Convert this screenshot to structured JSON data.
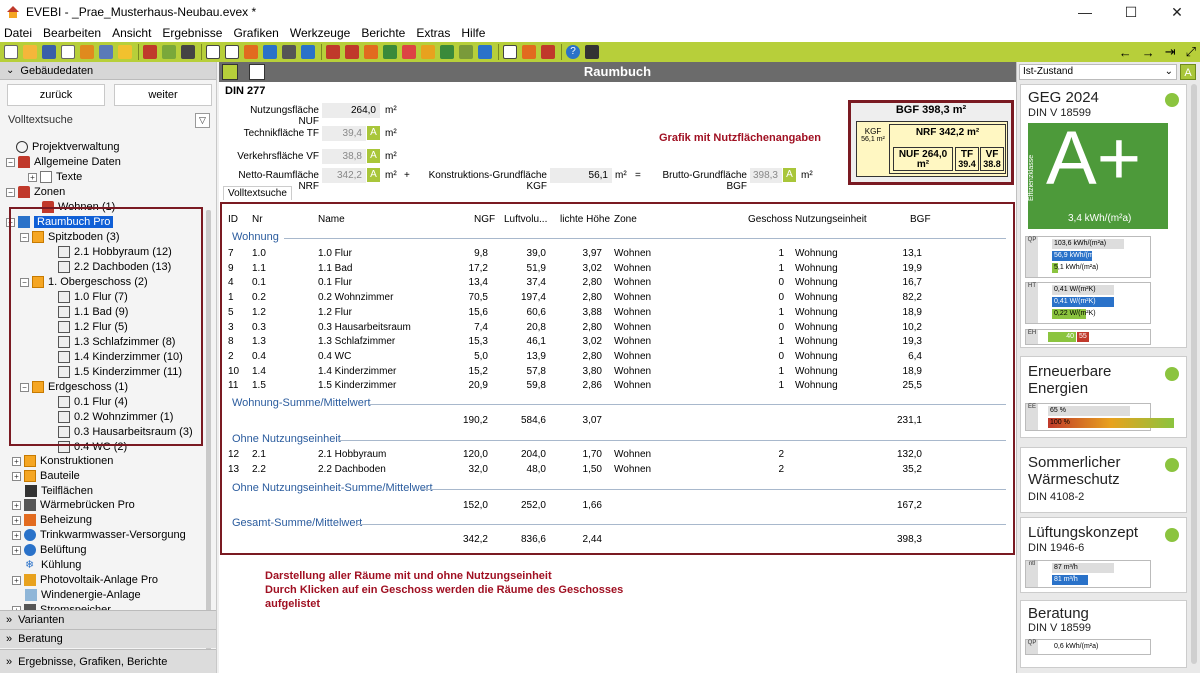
{
  "window": {
    "title": "EVEBI  - _Prae_Musterhaus-Neubau.evex *",
    "min": "—",
    "max": "☐",
    "close": "✕"
  },
  "menu": [
    "Datei",
    "Bearbeiten",
    "Ansicht",
    "Ergebnisse",
    "Grafiken",
    "Werkzeuge",
    "Berichte",
    "Extras",
    "Hilfe"
  ],
  "toolbar": {
    "back": "←",
    "forward": "→",
    "exit": "⇥",
    "zoom": "⤢"
  },
  "left": {
    "header": "Gebäudedaten",
    "back": "zurück",
    "next": "weiter",
    "search": "Volltextsuche",
    "tree": [
      {
        "label": "Projektverwaltung"
      },
      {
        "label": "Allgemeine Daten"
      },
      {
        "label": "Texte"
      },
      {
        "label": "Zonen"
      },
      {
        "label": "Wohnen (1)"
      },
      {
        "label": "Raumbuch Pro"
      },
      {
        "label": "Spitzboden (3)"
      },
      {
        "label": "2.1 Hobbyraum (12)"
      },
      {
        "label": "2.2 Dachboden (13)"
      },
      {
        "label": "1. Obergeschoss (2)"
      },
      {
        "label": "1.0 Flur (7)"
      },
      {
        "label": "1.1 Bad (9)"
      },
      {
        "label": "1.2 Flur (5)"
      },
      {
        "label": "1.3 Schlafzimmer (8)"
      },
      {
        "label": "1.4 Kinderzimmer (10)"
      },
      {
        "label": "1.5 Kinderzimmer (11)"
      },
      {
        "label": "Erdgeschoss (1)"
      },
      {
        "label": "0.1 Flur (4)"
      },
      {
        "label": "0.2 Wohnzimmer (1)"
      },
      {
        "label": "0.3 Hausarbeitsraum (3)"
      },
      {
        "label": "0.4 WC (2)"
      },
      {
        "label": "Konstruktionen"
      },
      {
        "label": "Bauteile"
      },
      {
        "label": "Teilflächen"
      },
      {
        "label": "Wärmebrücken Pro"
      },
      {
        "label": "Beheizung"
      },
      {
        "label": "Trinkwarmwasser-Versorgung"
      },
      {
        "label": "Belüftung"
      },
      {
        "label": "Kühlung"
      },
      {
        "label": "Photovoltaik-Anlage Pro"
      },
      {
        "label": "Windenergie-Anlage"
      },
      {
        "label": "Stromspeicher"
      }
    ],
    "sections": [
      "Varianten",
      "Beratung",
      "Ergebnisse, Grafiken, Berichte"
    ]
  },
  "main": {
    "title": "Raumbuch",
    "din": "DIN 277",
    "fields": {
      "nuf_label": "Nutzungsfläche NUF",
      "nuf": "264,0",
      "tf_label": "Technikfläche TF",
      "tf": "39,4",
      "vf_label": "Verkehrsfläche VF",
      "vf": "38,8",
      "nrf_label": "Netto-Raumfläche NRF",
      "nrf": "342,2",
      "kgf_label": "Konstruktions-Grundfläche KGF",
      "kgf": "56,1",
      "bgf_label": "Brutto-Grundfläche BGF",
      "bgf": "398,3",
      "unit": "m²",
      "a": "A",
      "plus": "+",
      "eq": "="
    },
    "graphic": {
      "bgf": "BGF 398,3 m²",
      "kgf": "KGF",
      "kgf_val": "56,1 m²",
      "nrf": "NRF 342,2 m²",
      "nuf": "NUF 264,0",
      "nuf_unit": "m²",
      "tf": "TF",
      "tf_val": "39.4",
      "vf": "VF",
      "vf_val": "38.8"
    },
    "annotation_graphic": "Grafik mit Nutzflächenangaben",
    "tab": "Volltextsuche",
    "columns": [
      "ID",
      "Nr",
      "Name",
      "NGF",
      "Luftvolu...",
      "lichte Höhe",
      "Zone",
      "Geschoss",
      "Nutzungseinheit",
      "BGF"
    ],
    "groups": [
      {
        "name": "Wohnung",
        "rows": [
          [
            "7",
            "1.0",
            "1.0 Flur",
            "9,8",
            "39,0",
            "3,97",
            "Wohnen",
            "1",
            "Wohnung",
            "13,1"
          ],
          [
            "9",
            "1.1",
            "1.1 Bad",
            "17,2",
            "51,9",
            "3,02",
            "Wohnen",
            "1",
            "Wohnung",
            "19,9"
          ],
          [
            "4",
            "0.1",
            "0.1 Flur",
            "13,4",
            "37,4",
            "2,80",
            "Wohnen",
            "0",
            "Wohnung",
            "16,7"
          ],
          [
            "1",
            "0.2",
            "0.2 Wohnzimmer",
            "70,5",
            "197,4",
            "2,80",
            "Wohnen",
            "0",
            "Wohnung",
            "82,2"
          ],
          [
            "5",
            "1.2",
            "1.2 Flur",
            "15,6",
            "60,6",
            "3,88",
            "Wohnen",
            "1",
            "Wohnung",
            "18,9"
          ],
          [
            "3",
            "0.3",
            "0.3 Hausarbeitsraum",
            "7,4",
            "20,8",
            "2,80",
            "Wohnen",
            "0",
            "Wohnung",
            "10,2"
          ],
          [
            "8",
            "1.3",
            "1.3 Schlafzimmer",
            "15,3",
            "46,1",
            "3,02",
            "Wohnen",
            "1",
            "Wohnung",
            "19,3"
          ],
          [
            "2",
            "0.4",
            "0.4 WC",
            "5,0",
            "13,9",
            "2,80",
            "Wohnen",
            "0",
            "Wohnung",
            "6,4"
          ],
          [
            "10",
            "1.4",
            "1.4 Kinderzimmer",
            "15,2",
            "57,8",
            "3,80",
            "Wohnen",
            "1",
            "Wohnung",
            "18,9"
          ],
          [
            "11",
            "1.5",
            "1.5 Kinderzimmer",
            "20,9",
            "59,8",
            "2,86",
            "Wohnen",
            "1",
            "Wohnung",
            "25,5"
          ]
        ],
        "sum_label": "Wohnung-Summe/Mittelwert",
        "sum": [
          "190,2",
          "584,6",
          "3,07",
          "231,1"
        ]
      },
      {
        "name": "Ohne Nutzungseinheit",
        "rows": [
          [
            "12",
            "2.1",
            "2.1 Hobbyraum",
            "120,0",
            "204,0",
            "1,70",
            "Wohnen",
            "2",
            "",
            "132,0"
          ],
          [
            "13",
            "2.2",
            "2.2 Dachboden",
            "32,0",
            "48,0",
            "1,50",
            "Wohnen",
            "2",
            "",
            "35,2"
          ]
        ],
        "sum_label": "Ohne Nutzungseinheit-Summe/Mittelwert",
        "sum": [
          "152,0",
          "252,0",
          "1,66",
          "167,2"
        ]
      }
    ],
    "total_label": "Gesamt-Summe/Mittelwert",
    "total": [
      "342,2",
      "836,6",
      "2,44",
      "398,3"
    ],
    "annotation_bottom": [
      "Darstellung aller Räume mit und ohne Nutzungseinheit",
      "Durch Klicken auf ein Geschoss werden die Räume des Geschosses",
      "aufgelistet"
    ]
  },
  "right": {
    "state": "Ist-Zustand",
    "a_btn": "A",
    "geg": {
      "title": "GEG 2024",
      "sub": "DIN V 18599",
      "class": "A+",
      "value": "3,4 kWh/(m²a)",
      "vlabel": "Effizienzklasse",
      "qp": [
        "103,6 kWh/(m²a)",
        "56,9 kWh/(m²a)",
        "5,1 kWh/(m²a)"
      ],
      "qp_lbl": "QP",
      "ht": [
        "0,41 W/(m²K)",
        "0,41 W/(m²K)",
        "0,22 W/(m²K)"
      ],
      "ht_lbl": "HT",
      "eh": [
        "40",
        "55"
      ],
      "eh_lbl": "EH"
    },
    "ee": {
      "title1": "Erneuerbare",
      "title2": "Energien",
      "vals": [
        "65 %",
        "100 %"
      ],
      "lbl": "EE"
    },
    "sw": {
      "title1": "Sommerlicher",
      "title2": "Wärmeschutz",
      "sub": "DIN 4108-2"
    },
    "lk": {
      "title": "Lüftungskonzept",
      "sub": "DIN 1946-6",
      "vals": [
        "87 m³/h",
        "81 m³/h"
      ],
      "lbl": "ntl"
    },
    "ber": {
      "title": "Beratung",
      "sub": "DIN V 18599",
      "val": "0,6 kWh/(m²a)",
      "lbl": "QP"
    }
  }
}
